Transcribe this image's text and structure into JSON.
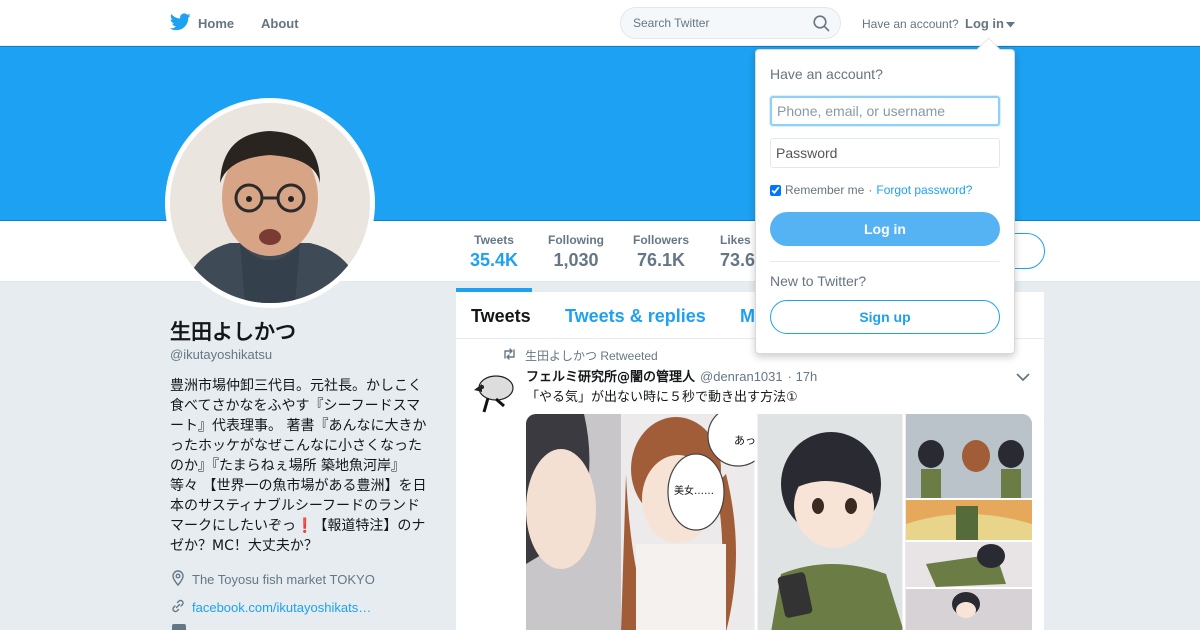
{
  "colors": {
    "brand": "#1da1f2",
    "banner": "#1da1f2",
    "text_secondary": "#657786"
  },
  "nav": {
    "home_label": "Home",
    "about_label": "About",
    "search_placeholder": "Search Twitter",
    "have_account": "Have an account?",
    "login_label": "Log in"
  },
  "profile": {
    "name": "生田よしかつ",
    "handle": "@ikutayoshikatsu",
    "bio": "豊洲市場仲卸三代目。元社長。かしこく食べてさかなをふやす『シーフードスマート』代表理事。 著書『あんなに大きかったホッケがなぜこんなに小さくなったのか』『たまらねぇ場所 築地魚河岸』等々 【世界一の魚市場がある豊洲】を日本のサスティナブルシーフードのランドマークにしたいぞっ❗️【報道特注】のナゼか？MC！大丈夫か？",
    "location": "The Toyosu fish market TOKYO",
    "website": "facebook.com/ikutayoshikats…"
  },
  "stats": [
    {
      "label": "Tweets",
      "value": "35.4K"
    },
    {
      "label": "Following",
      "value": "1,030"
    },
    {
      "label": "Followers",
      "value": "76.1K"
    },
    {
      "label": "Likes",
      "value": "73.6"
    }
  ],
  "timeline": {
    "tabs": [
      "Tweets",
      "Tweets & replies",
      "M"
    ],
    "tweet": {
      "retweet_line": "生田よしかつ Retweeted",
      "name": "フェルミ研究所@闇の管理人",
      "handle": "@denran1031",
      "time": "· 17h",
      "text": "「やる気」が出ない時に５秒で動き出す方法①",
      "speech_1": "あっ",
      "speech_2": "美女……"
    }
  },
  "login_dropdown": {
    "title": "Have an account?",
    "username_placeholder": "Phone, email, or username",
    "password_placeholder": "Password",
    "remember_me": "Remember me",
    "separator": "·",
    "forgot": "Forgot password?",
    "login_button": "Log in",
    "new_to_twitter": "New to Twitter?",
    "signup_button": "Sign up"
  }
}
